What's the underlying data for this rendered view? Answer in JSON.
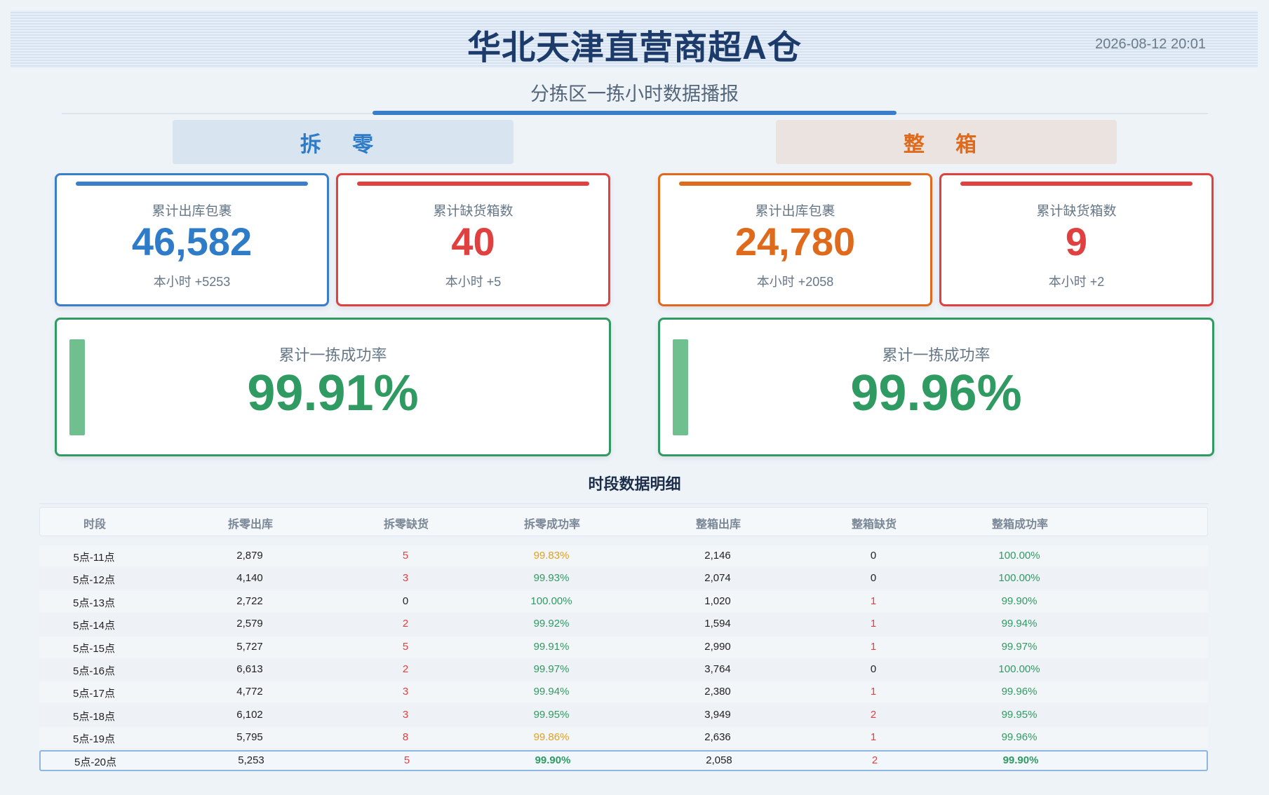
{
  "header": {
    "title": "华北天津直营商超A仓",
    "datetime": "2026-08-12 20:01",
    "subtitle": "分拣区一拣小时数据播报"
  },
  "sections": {
    "left": "拆 零",
    "right": "整 箱"
  },
  "colors": {
    "blue": "#2e7bc8",
    "red": "#e04040",
    "orange": "#e06a1c",
    "green": "#2f9a62",
    "amber": "#e0a020"
  },
  "cards": {
    "split_out": {
      "label": "累计出库包裹",
      "value": "46,582",
      "delta": "本小时 +5253"
    },
    "split_short": {
      "label": "累计缺货箱数",
      "value": "40",
      "delta": "本小时 +5"
    },
    "box_out": {
      "label": "累计出库包裹",
      "value": "24,780",
      "delta": "本小时 +2058"
    },
    "box_short": {
      "label": "累计缺货箱数",
      "value": "9",
      "delta": "本小时 +2"
    },
    "split_rate": {
      "label": "累计一拣成功率",
      "value": "99.91%"
    },
    "box_rate": {
      "label": "累计一拣成功率",
      "value": "99.96%"
    }
  },
  "table": {
    "title": "时段数据明细",
    "headers": [
      "时段",
      "拆零出库",
      "拆零缺货",
      "拆零成功率",
      "整箱出库",
      "整箱缺货",
      "整箱成功率"
    ],
    "rows": [
      [
        "5点-11点",
        "2,879",
        "5",
        "99.83%",
        "2,146",
        "0",
        "100.00%"
      ],
      [
        "5点-12点",
        "4,140",
        "3",
        "99.93%",
        "2,074",
        "0",
        "100.00%"
      ],
      [
        "5点-13点",
        "2,722",
        "0",
        "100.00%",
        "1,020",
        "1",
        "99.90%"
      ],
      [
        "5点-14点",
        "2,579",
        "2",
        "99.92%",
        "1,594",
        "1",
        "99.94%"
      ],
      [
        "5点-15点",
        "5,727",
        "5",
        "99.91%",
        "2,990",
        "1",
        "99.97%"
      ],
      [
        "5点-16点",
        "6,613",
        "2",
        "99.97%",
        "3,764",
        "0",
        "100.00%"
      ],
      [
        "5点-17点",
        "4,772",
        "3",
        "99.94%",
        "2,380",
        "1",
        "99.96%"
      ],
      [
        "5点-18点",
        "6,102",
        "3",
        "99.95%",
        "3,949",
        "2",
        "99.95%"
      ],
      [
        "5点-19点",
        "5,795",
        "8",
        "99.86%",
        "2,636",
        "1",
        "99.96%"
      ],
      [
        "5点-20点",
        "5,253",
        "5",
        "99.90%",
        "2,058",
        "2",
        "99.90%"
      ]
    ]
  }
}
